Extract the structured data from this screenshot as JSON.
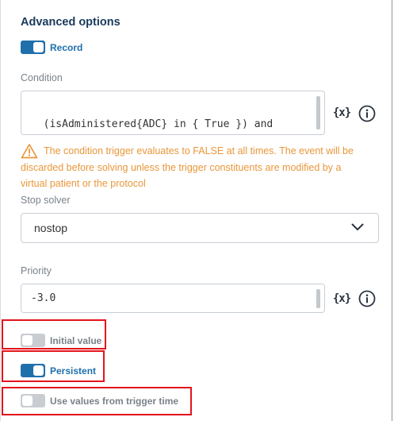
{
  "section": {
    "title": "Advanced options"
  },
  "record": {
    "label": "Record",
    "on": true
  },
  "condition": {
    "label": "Condition",
    "value": "(isAdministered{ADC} in { True }) and\n(removing{ADC} in { True })",
    "variable_icon": "{x}",
    "info_icon": "info-icon"
  },
  "warning": {
    "icon": "warning-triangle-icon",
    "text": "The condition trigger evaluates to FALSE at all times. The event will be discarded before solving unless the trigger constituents are modified by a virtual patient or the protocol"
  },
  "stop_solver": {
    "label": "Stop solver",
    "value": "nostop"
  },
  "priority": {
    "label": "Priority",
    "value": "-3.0",
    "variable_icon": "{x}"
  },
  "initial_value": {
    "label": "Initial value",
    "on": false
  },
  "persistent": {
    "label": "Persistent",
    "on": true
  },
  "use_trigger_time": {
    "label": "Use values from trigger time",
    "on": false
  },
  "colors": {
    "accent": "#1f6fab",
    "warning": "#e8973a",
    "highlight": "#e4141c",
    "toggle_off": "#c9cdd2"
  }
}
